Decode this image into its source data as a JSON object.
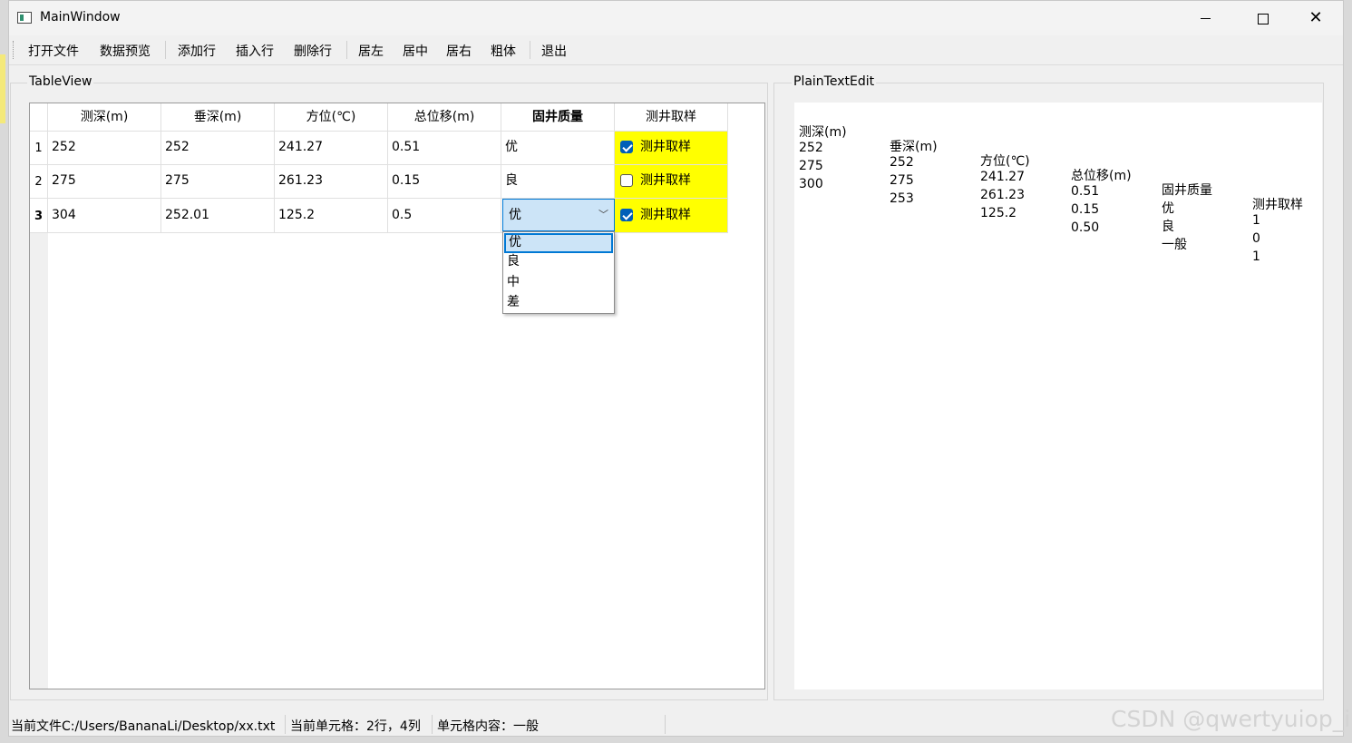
{
  "window": {
    "title": "MainWindow",
    "min_glyph": "—",
    "close_glyph": "✕"
  },
  "toolbar": {
    "open_file": "打开文件",
    "data_preview": "数据预览",
    "add_row": "添加行",
    "insert_row": "插入行",
    "delete_row": "删除行",
    "align_left": "居左",
    "align_center": "居中",
    "align_right": "居右",
    "bold": "粗体",
    "exit": "退出"
  },
  "left_group": {
    "title": "TableView",
    "headers": [
      "测深(m)",
      "垂深(m)",
      "方位(℃)",
      "总位移(m)",
      "固井质量",
      "测井取样"
    ],
    "rows": [
      {
        "num": "1",
        "cells": [
          "252",
          "252",
          "241.27",
          "0.51",
          "优"
        ],
        "sample_label": "测井取样",
        "checked": true
      },
      {
        "num": "2",
        "cells": [
          "275",
          "275",
          "261.23",
          "0.15",
          "良"
        ],
        "sample_label": "测井取样",
        "checked": false
      },
      {
        "num": "3",
        "cells": [
          "304",
          "252.01",
          "125.2",
          "0.5",
          "优"
        ],
        "sample_label": "测井取样",
        "checked": true
      }
    ],
    "combo_value": "优",
    "combo_options": [
      "优",
      "良",
      "中",
      "差"
    ],
    "highlight_color": "#ffff00",
    "accent_color": "#0078d4"
  },
  "right_group": {
    "title": "PlainTextEdit",
    "lines": [
      [
        "测深(m)",
        "垂深(m)",
        "方位(℃)",
        "总位移(m)",
        "固井质量",
        "测井取样"
      ],
      [
        "252",
        "252",
        "241.27",
        "0.51",
        "优",
        "1"
      ],
      [
        "275",
        "275",
        "261.23",
        "0.15",
        "良",
        "0"
      ],
      [
        "300",
        "253",
        "125.2",
        "0.50",
        "一般",
        "1"
      ]
    ]
  },
  "statusbar": {
    "current_file": "当前文件C:/Users/BananaLi/Desktop/xx.txt",
    "current_cell": "当前单元格：2行，4列",
    "cell_content": "单元格内容：一般"
  },
  "watermark": "CSDN @qwertyuiop_i"
}
